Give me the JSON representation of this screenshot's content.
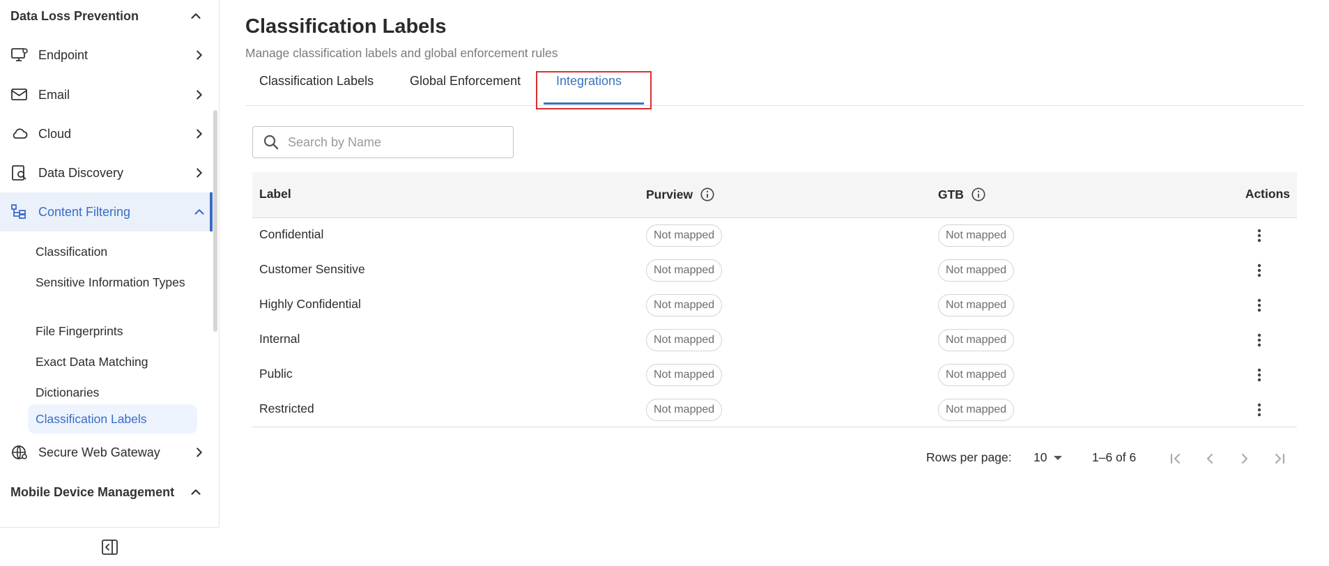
{
  "sidebar": {
    "section_dlp": "Data Loss Prevention",
    "items": [
      {
        "label": "Endpoint",
        "icon": "monitor-icon"
      },
      {
        "label": "Email",
        "icon": "mail-icon"
      },
      {
        "label": "Cloud",
        "icon": "cloud-icon"
      },
      {
        "label": "Data Discovery",
        "icon": "data-discovery-icon"
      },
      {
        "label": "Content Filtering",
        "icon": "content-filtering-icon"
      }
    ],
    "sub_items": [
      "Classification",
      "Sensitive Information Types",
      "File Fingerprints",
      "Exact Data Matching",
      "Dictionaries",
      "Classification Labels"
    ],
    "swg": {
      "label": "Secure Web Gateway",
      "icon": "globe-icon"
    },
    "section_mdm": "Mobile Device Management",
    "accent": "#3a6bc7"
  },
  "main": {
    "title": "Classification Labels",
    "subtitle": "Manage classification labels and global enforcement rules",
    "tabs": [
      "Classification Labels",
      "Global Enforcement",
      "Integrations"
    ],
    "active_tab": "Integrations",
    "search": {
      "placeholder": "Search by Name",
      "value": ""
    },
    "table": {
      "headers": [
        "Label",
        "Purview",
        "GTB",
        "Actions"
      ],
      "rows": [
        {
          "label": "Confidential",
          "purview": "Not mapped",
          "gtb": "Not mapped"
        },
        {
          "label": "Customer Sensitive",
          "purview": "Not mapped",
          "gtb": "Not mapped"
        },
        {
          "label": "Highly Confidential",
          "purview": "Not mapped",
          "gtb": "Not mapped"
        },
        {
          "label": "Internal",
          "purview": "Not mapped",
          "gtb": "Not mapped"
        },
        {
          "label": "Public",
          "purview": "Not mapped",
          "gtb": "Not mapped"
        },
        {
          "label": "Restricted",
          "purview": "Not mapped",
          "gtb": "Not mapped"
        }
      ]
    },
    "pagination": {
      "rows_per_page_label": "Rows per page:",
      "rows_per_page": "10",
      "range": "1–6 of 6"
    }
  }
}
